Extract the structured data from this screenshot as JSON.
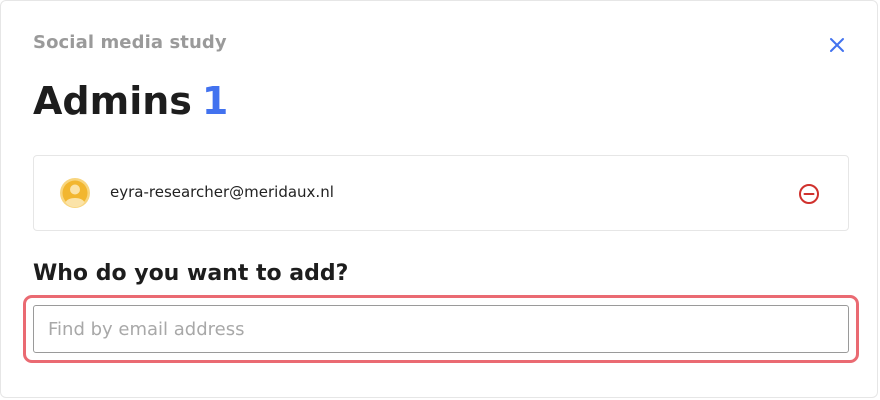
{
  "dialog": {
    "subtitle": "Social media study",
    "title": "Admins",
    "admin_count": "1",
    "close_icon": "close-icon"
  },
  "admins": [
    {
      "email": "eyra-researcher@meridaux.nl",
      "avatar_icon": "user-avatar-icon",
      "remove_icon": "remove-circle-icon"
    }
  ],
  "add_section": {
    "heading": "Who do you want to add?",
    "search": {
      "placeholder": "Find by email address",
      "value": ""
    }
  },
  "colors": {
    "accent": "#4272ef",
    "danger": "#d0312d",
    "focus_ring": "#ea6a72",
    "avatar": "#f2b62f",
    "muted_text": "#9a9a9a"
  }
}
